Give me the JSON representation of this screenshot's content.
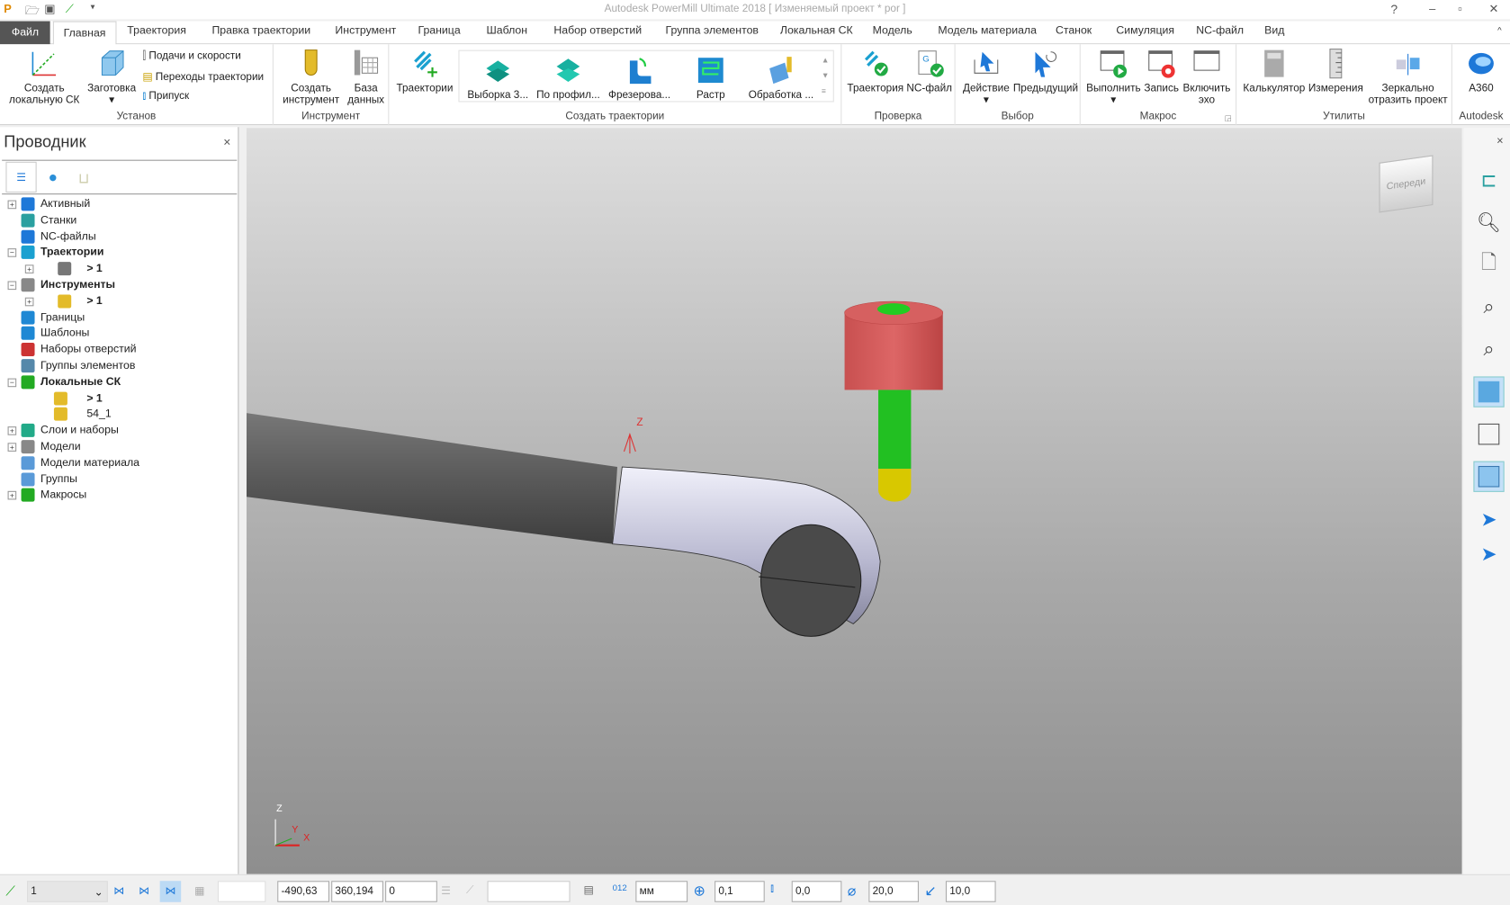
{
  "window": {
    "title": "Autodesk PowerMill Ultimate 2018   [ Изменяемый проект * por ]"
  },
  "tabs": [
    "Файл",
    "Главная",
    "Траектория",
    "Правка траектории",
    "Инструмент",
    "Граница",
    "Шаблон",
    "Набор отверстий",
    "Группа элементов",
    "Локальная СК",
    "Модель",
    "Модель материала",
    "Станок",
    "Симуляция",
    "NC-файл",
    "Вид"
  ],
  "active_tab": "Главная",
  "ribbon": {
    "ustanov": {
      "label": "Установ",
      "create_cs": "Создать",
      "create_cs2": "локальную СК",
      "stock": "Заготовка",
      "feeds": "Подачи и скорости",
      "links": "Переходы траектории",
      "thickness": "Припуск"
    },
    "tool": {
      "label": "Инструмент",
      "create": "Создать",
      "create2": "инструмент",
      "db": "База",
      "db2": "данных"
    },
    "create_tp": {
      "label": "Создать траектории",
      "toolpaths": "Траектории",
      "gallery": [
        "Выборка 3...",
        "По профил...",
        "Фрезерова...",
        "Растр",
        "Обработка ..."
      ]
    },
    "verify": {
      "label": "Проверка",
      "toolpath": "Траектория",
      "ncfile": "NC-файл"
    },
    "select": {
      "label": "Выбор",
      "action": "Действие",
      "previous": "Предыдущий"
    },
    "macro": {
      "label": "Макрос",
      "run": "Выполнить",
      "record": "Запись",
      "echo": "Включить",
      "echo2": "эхо"
    },
    "utils": {
      "label": "Утилиты",
      "calc": "Калькулятор",
      "measure": "Измерения",
      "mirror": "Зеркально",
      "mirror2": "отразить проект"
    },
    "autodesk": {
      "label": "Autodesk",
      "a360": "A360"
    }
  },
  "explorer": {
    "title": "Проводник",
    "items": [
      {
        "label": "Активный",
        "bold": false
      },
      {
        "label": "Станки",
        "bold": false
      },
      {
        "label": "NC-файлы",
        "bold": false
      },
      {
        "label": "Траектории",
        "bold": true
      },
      {
        "label": "> 1",
        "bold": true
      },
      {
        "label": "Инструменты",
        "bold": true
      },
      {
        "label": "> 1",
        "bold": true
      },
      {
        "label": "Границы",
        "bold": false
      },
      {
        "label": "Шаблоны",
        "bold": false
      },
      {
        "label": "Наборы отверстий",
        "bold": false
      },
      {
        "label": "Группы элементов",
        "bold": false
      },
      {
        "label": "Локальные СК",
        "bold": true
      },
      {
        "label": "> 1",
        "bold": true
      },
      {
        "label": "54_1",
        "bold": false
      },
      {
        "label": "Слои и наборы",
        "bold": false
      },
      {
        "label": "Модели",
        "bold": false
      },
      {
        "label": "Модели материала",
        "bold": false
      },
      {
        "label": "Группы",
        "bold": false
      },
      {
        "label": "Макросы",
        "bold": false
      }
    ]
  },
  "viewport": {
    "viewcube": "Спереди",
    "axis_z": "Z",
    "axis_y": "Y",
    "axis_x": "X"
  },
  "status": {
    "cs": "1",
    "x": "-490,63",
    "y": "360,194",
    "z": "0",
    "units": "мм",
    "tolerance": "0,1",
    "thickness": "0,0",
    "diameter": "20,0",
    "stepover": "10,0"
  },
  "colors": {
    "file_tab": "#555555",
    "accent": "#1e88d4",
    "tool_holder": "#c85a5a",
    "tool_shank": "#22c022",
    "tool_tip": "#d4c400"
  }
}
